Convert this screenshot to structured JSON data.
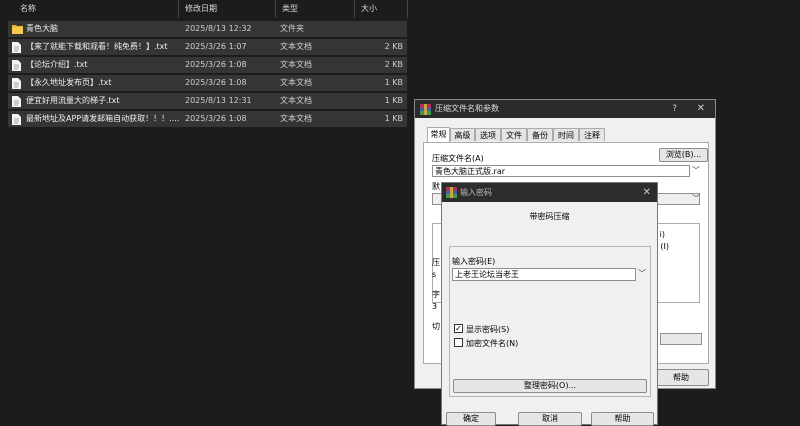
{
  "explorer": {
    "columns": {
      "name": "名称",
      "modified": "修改日期",
      "type": "类型",
      "size": "大小"
    },
    "rows": [
      {
        "name": "青色大脑",
        "modified": "2025/8/13 12:32",
        "type": "文件夹",
        "size": "",
        "icon": "folder-icon"
      },
      {
        "name": "【来了就能下载和观看！纯免费！】.txt",
        "modified": "2025/3/26 1:07",
        "type": "文本文档",
        "size": "2 KB",
        "icon": "text-file-icon"
      },
      {
        "name": "【论坛介绍】.txt",
        "modified": "2025/3/26 1:08",
        "type": "文本文档",
        "size": "2 KB",
        "icon": "text-file-icon"
      },
      {
        "name": "【永久地址发布页】.txt",
        "modified": "2025/3/26 1:08",
        "type": "文本文档",
        "size": "1 KB",
        "icon": "text-file-icon"
      },
      {
        "name": "便宜好用流量大的梯子.txt",
        "modified": "2025/8/13 12:31",
        "type": "文本文档",
        "size": "1 KB",
        "icon": "text-file-icon"
      },
      {
        "name": "最新地址及APP请发邮箱自动获取！！！....",
        "modified": "2025/3/26 1:08",
        "type": "文本文档",
        "size": "1 KB",
        "icon": "text-file-icon"
      }
    ]
  },
  "archive_dialog": {
    "title": "压缩文件名和参数",
    "help_char": "?",
    "close_char": "✕",
    "tabs": [
      "常规",
      "高级",
      "选项",
      "文件",
      "备份",
      "时间",
      "注释"
    ],
    "archive_name_label": "压缩文件名(A)",
    "archive_name_value": "青色大脑正式版.rar",
    "browse_label": "浏览(B)...",
    "partial_labels": [
      "默",
      "压",
      "s",
      "字",
      "3",
      "切"
    ],
    "partial_right_texts": [
      "i)",
      "(I)"
    ],
    "help_button": "帮助"
  },
  "password_dialog": {
    "title": "输入密码",
    "close_char": "✕",
    "heading": "带密码压缩",
    "password_label": "输入密码(E)",
    "password_value": "上老王论坛当老王",
    "show_password_label": "显示密码(S)",
    "show_password_checked": true,
    "encrypt_names_label": "加密文件名(N)",
    "encrypt_names_checked": false,
    "organize_button": "整理密码(O)...",
    "ok_button": "确定",
    "cancel_button": "取消",
    "help_button": "帮助"
  },
  "colors": {
    "accent": "#2b2b2b",
    "folder": "#e8b232",
    "background": "#1c1c1c"
  }
}
